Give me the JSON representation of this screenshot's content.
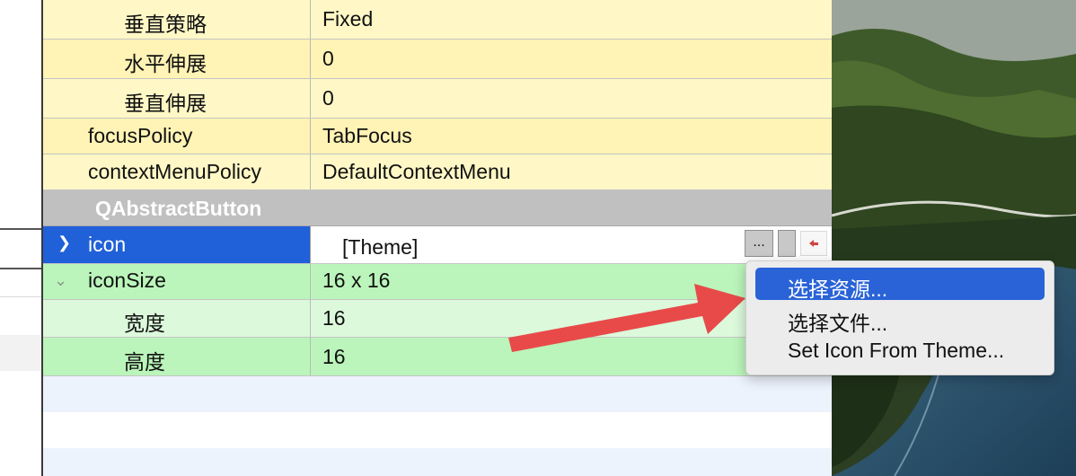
{
  "properties": [
    {
      "name": "垂直策略",
      "value": "Fixed",
      "indent": 2,
      "color": "#fff8c6"
    },
    {
      "name": "水平伸展",
      "value": "0",
      "indent": 2,
      "color": "#fff3b5"
    },
    {
      "name": "垂直伸展",
      "value": "0",
      "indent": 2,
      "color": "#fff8c6"
    },
    {
      "name": "focusPolicy",
      "value": "TabFocus",
      "indent": 1,
      "color": "#fff3b5"
    },
    {
      "name": "contextMenuPolicy",
      "value": "DefaultContextMenu",
      "indent": 1,
      "color": "#fff8c6"
    }
  ],
  "section_header": "QAbstractButton",
  "icon_row": {
    "name": "icon",
    "value": "[Theme]",
    "dots_label": "..."
  },
  "icon_size": {
    "name": "iconSize",
    "value": "16 x 16"
  },
  "width_row": {
    "name": "宽度",
    "value": "16"
  },
  "height_row": {
    "name": "高度",
    "value": "16"
  },
  "context_menu": {
    "items": [
      "选择资源...",
      "选择文件...",
      "Set Icon From Theme..."
    ],
    "highlighted_index": 0
  },
  "colors": {
    "selection": "#2060d8",
    "menu_highlight": "#2a63d8",
    "section_header": "#c0c0c0",
    "annotation_arrow": "#e84a4a"
  }
}
